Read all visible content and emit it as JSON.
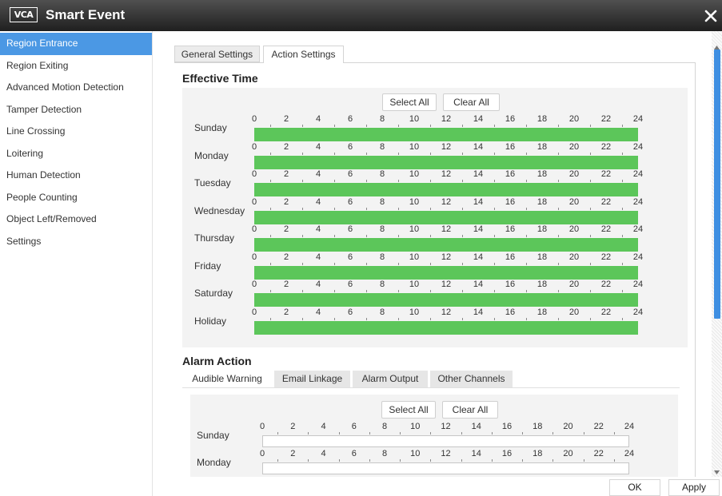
{
  "window": {
    "logo_text": "VCA",
    "title": "Smart Event"
  },
  "icons": {
    "close": "close-icon",
    "scroll_up": "chevron-up-icon",
    "scroll_down": "chevron-down-icon"
  },
  "sidebar": {
    "items": [
      {
        "label": "Region Entrance",
        "selected": true
      },
      {
        "label": "Region Exiting",
        "selected": false
      },
      {
        "label": "Advanced Motion Detection",
        "selected": false
      },
      {
        "label": "Tamper Detection",
        "selected": false
      },
      {
        "label": "Line Crossing",
        "selected": false
      },
      {
        "label": "Loitering",
        "selected": false
      },
      {
        "label": "Human Detection",
        "selected": false
      },
      {
        "label": "People Counting",
        "selected": false
      },
      {
        "label": "Object Left/Removed",
        "selected": false
      },
      {
        "label": "Settings",
        "selected": false
      }
    ]
  },
  "tabs": [
    {
      "label": "General Settings",
      "active": false
    },
    {
      "label": "Action Settings",
      "active": true
    }
  ],
  "effective_time": {
    "heading": "Effective Time",
    "select_all_label": "Select All",
    "clear_all_label": "Clear All",
    "hour_ticks": [
      "0",
      "2",
      "4",
      "6",
      "8",
      "10",
      "12",
      "14",
      "16",
      "18",
      "20",
      "22",
      "24"
    ],
    "days": [
      {
        "label": "Sunday",
        "schedule": [
          [
            0,
            24
          ]
        ]
      },
      {
        "label": "Monday",
        "schedule": [
          [
            0,
            24
          ]
        ]
      },
      {
        "label": "Tuesday",
        "schedule": [
          [
            0,
            24
          ]
        ]
      },
      {
        "label": "Wednesday",
        "schedule": [
          [
            0,
            24
          ]
        ]
      },
      {
        "label": "Thursday",
        "schedule": [
          [
            0,
            24
          ]
        ]
      },
      {
        "label": "Friday",
        "schedule": [
          [
            0,
            24
          ]
        ]
      },
      {
        "label": "Saturday",
        "schedule": [
          [
            0,
            24
          ]
        ]
      },
      {
        "label": "Holiday",
        "schedule": [
          [
            0,
            24
          ]
        ]
      }
    ]
  },
  "alarm_action": {
    "heading": "Alarm Action",
    "tabs": [
      {
        "label": "Audible Warning",
        "active": true
      },
      {
        "label": "Email Linkage",
        "active": false
      },
      {
        "label": "Alarm Output",
        "active": false
      },
      {
        "label": "Other Channels",
        "active": false
      }
    ],
    "select_all_label": "Select All",
    "clear_all_label": "Clear All",
    "hour_ticks": [
      "0",
      "2",
      "4",
      "6",
      "8",
      "10",
      "12",
      "14",
      "16",
      "18",
      "20",
      "22",
      "24"
    ],
    "days": [
      {
        "label": "Sunday",
        "schedule": []
      },
      {
        "label": "Monday",
        "schedule": []
      }
    ]
  },
  "footer": {
    "ok_label": "OK",
    "apply_label": "Apply"
  },
  "colors": {
    "accent": "#4b98e4",
    "schedule_fill": "#5cc65a",
    "panel_bg": "#f3f3f3",
    "scrollbar_thumb": "#3f8fe2"
  }
}
